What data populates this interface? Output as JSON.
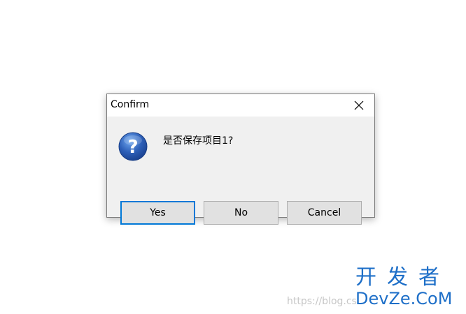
{
  "dialog": {
    "title": "Confirm",
    "message": "是否保存项目1?",
    "buttons": {
      "yes": "Yes",
      "no": "No",
      "cancel": "Cancel"
    },
    "default_button": "yes",
    "icon": "question-icon",
    "close_icon": "close-icon"
  },
  "watermark": {
    "url": "https://blog.cs",
    "logo_cn": "开发者",
    "logo_en": "DevZe.CoM"
  },
  "colors": {
    "accent": "#0078d7",
    "button_face": "#e1e1e1",
    "dialog_bg": "#f0f0f0",
    "watermark_blue": "#1e6fc8"
  }
}
